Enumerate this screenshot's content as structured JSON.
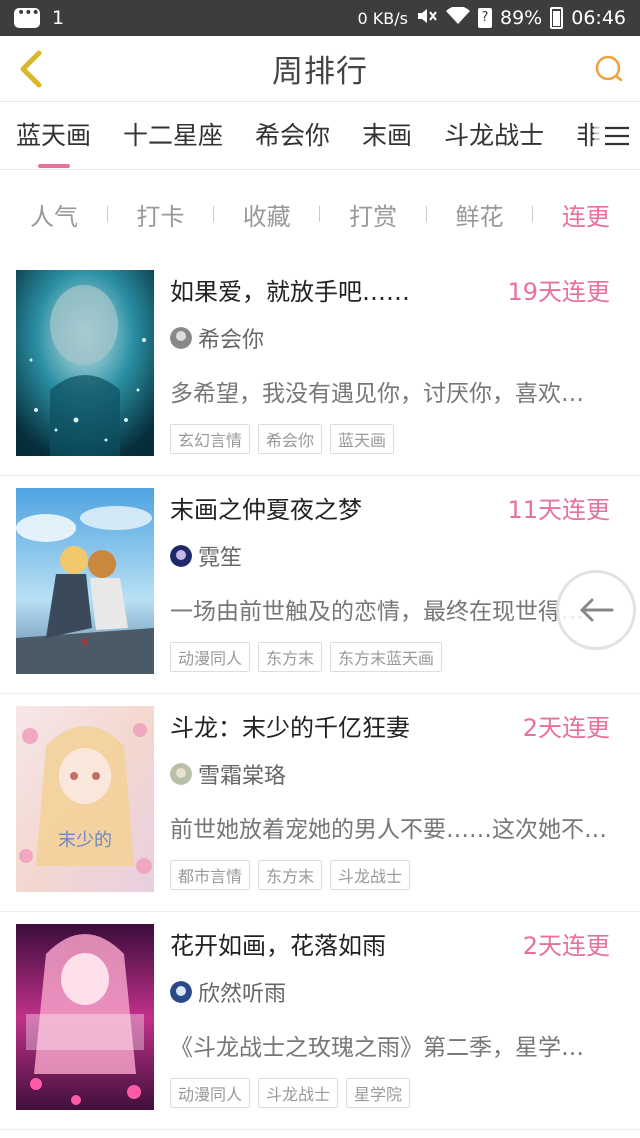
{
  "status_bar": {
    "notification_count": "1",
    "speed": "0 KB/s",
    "battery": "89%",
    "time": "06:46",
    "icons": [
      "message-icon",
      "mute-icon",
      "wifi-icon",
      "sim-icon",
      "battery-icon"
    ]
  },
  "header": {
    "title": "周排行",
    "back_icon": "chevron-left-icon",
    "search_icon": "search-icon",
    "accent": "#e8709c"
  },
  "categories": {
    "tabs": [
      "蓝天画",
      "十二星座",
      "希会你",
      "末画",
      "斗龙战士",
      "非"
    ],
    "active_index": 0,
    "menu_icon": "menu-icon"
  },
  "sort": {
    "options": [
      "人气",
      "打卡",
      "收藏",
      "打赏",
      "鲜花",
      "连更"
    ],
    "active_index": 5
  },
  "items": [
    {
      "title": "如果爱，就放手吧……",
      "streak": "19天连更",
      "author": "希会你",
      "desc": "多希望，我没有遇见你，讨厌你，喜欢…",
      "tags": [
        "玄幻言情",
        "希会你",
        "蓝天画"
      ]
    },
    {
      "title": "末画之仲夏夜之梦",
      "streak": "11天连更",
      "author": "霓笙",
      "desc": "一场由前世触及的恋情，最终在现世得…",
      "tags": [
        "动漫同人",
        "东方末",
        "东方末蓝天画"
      ]
    },
    {
      "title": "斗龙：末少的千亿狂妻",
      "streak": "2天连更",
      "author": "雪霜棠珞",
      "desc": "前世她放着宠她的男人不要……这次她不…",
      "tags": [
        "都市言情",
        "东方末",
        "斗龙战士"
      ]
    },
    {
      "title": "花开如画，花落如雨",
      "streak": "2天连更",
      "author": "欣然听雨",
      "desc": "《斗龙战士之玫瑰之雨》第二季，星学…",
      "tags": [
        "动漫同人",
        "斗龙战士",
        "星学院"
      ]
    }
  ],
  "float_button_icon": "arrow-left-icon"
}
